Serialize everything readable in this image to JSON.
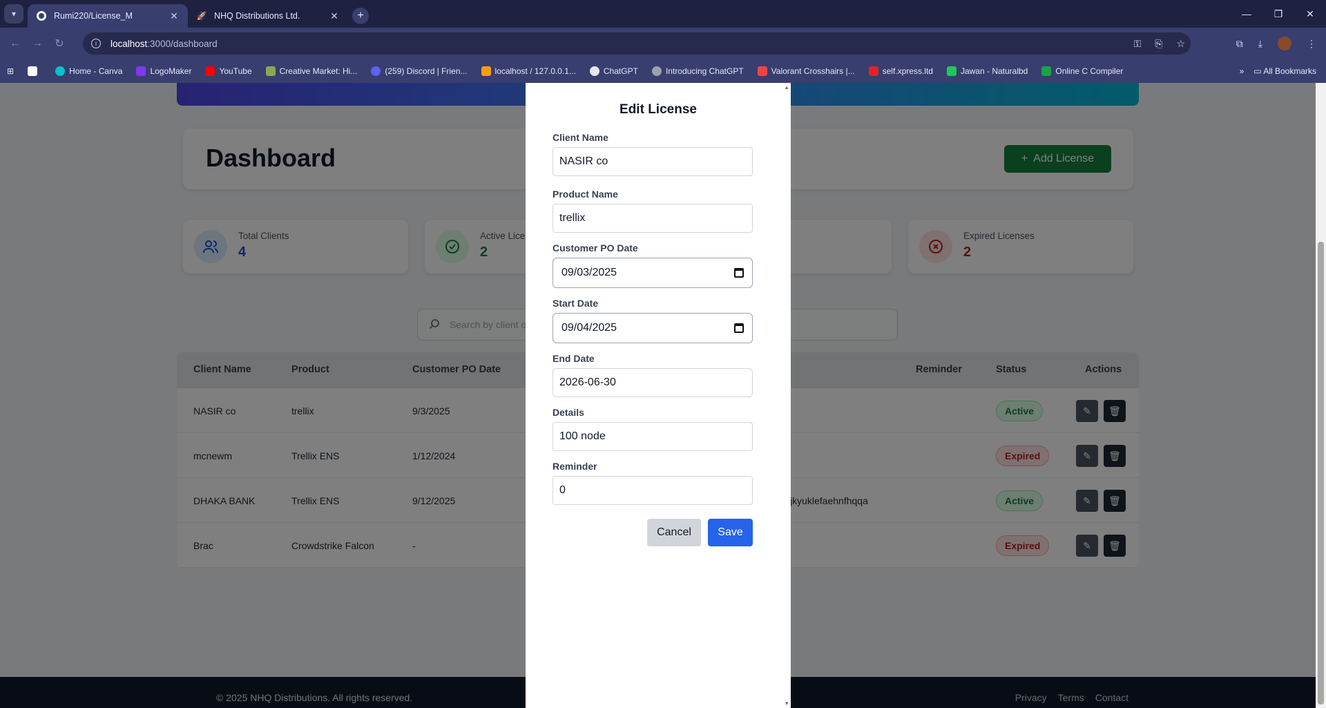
{
  "browser": {
    "tabs": [
      {
        "label": "Rumi220/License_M",
        "icon": "github-icon"
      },
      {
        "label": "NHQ Distributions Ltd.",
        "icon": "rocket-icon"
      }
    ],
    "url_host": "localhost",
    "url_path": ":3000/dashboard",
    "bookmarks": [
      {
        "label": "Home - Canva",
        "color": "#00c4cc"
      },
      {
        "label": "LogoMaker",
        "color": "#7c3aed"
      },
      {
        "label": "YouTube",
        "color": "#ff0000"
      },
      {
        "label": "Creative Market: Hi...",
        "color": "#8ba753"
      },
      {
        "label": "(259) Discord | Frien...",
        "color": "#5865f2"
      },
      {
        "label": "localhost / 127.0.0.1...",
        "color": "#f59e0b"
      },
      {
        "label": "ChatGPT",
        "color": "#e5e7eb"
      },
      {
        "label": "Introducing ChatGPT",
        "color": "#9ca3af"
      },
      {
        "label": "Valorant Crosshairs |...",
        "color": "#ef4444"
      },
      {
        "label": "self.xpress.ltd",
        "color": "#dc2626"
      },
      {
        "label": "Jawan - Naturalbd",
        "color": "#22c55e"
      },
      {
        "label": "Online C Compiler",
        "color": "#16a34a"
      }
    ],
    "all_bookmarks": "All Bookmarks"
  },
  "dashboard": {
    "title": "Dashboard",
    "add_button": "Add License",
    "stats": [
      {
        "label": "Total Clients",
        "value": "4",
        "color": "#1d4ed8",
        "bg": "#dbeafe"
      },
      {
        "label": "Active Lice",
        "value": "2",
        "color": "#15803d",
        "bg": "#dcfce7"
      },
      {
        "label": "Expired Licenses",
        "value": "2",
        "color": "#b91c1c",
        "bg": "#fee2e2"
      }
    ],
    "search_placeholder": "Search by client o"
  },
  "table": {
    "headers": [
      "Client Name",
      "Product",
      "Customer PO Date",
      "Reminder",
      "Status",
      "Actions"
    ],
    "rows": [
      {
        "client": "NASIR co",
        "product": "trellix",
        "po_date": "9/3/2025",
        "extra": "",
        "status": "Active"
      },
      {
        "client": "mcnewm",
        "product": "Trellix ENS",
        "po_date": "1/12/2024",
        "extra": "",
        "status": "Expired"
      },
      {
        "client": "DHAKA BANK",
        "product": "Trellix ENS",
        "po_date": "9/12/2025",
        "extra": "jkyuklefaehnfhqqa",
        "status": "Active"
      },
      {
        "client": "Brac",
        "product": "Crowdstrike Falcon",
        "po_date": "-",
        "extra": "",
        "status": "Expired"
      }
    ]
  },
  "footer": {
    "copyright": "© 2025 NHQ Distributions. All rights reserved.",
    "links": [
      "Privacy",
      "Terms",
      "Contact"
    ]
  },
  "modal": {
    "title": "Edit License",
    "client_name_label": "Client Name",
    "client_name_value": "NASIR co",
    "product_name_label": "Product Name",
    "product_name_value": "trellix",
    "po_date_label": "Customer PO Date",
    "po_date_value": "09/03/2025",
    "start_date_label": "Start Date",
    "start_date_value": "09/04/2025",
    "end_date_label": "End Date",
    "end_date_value": "2026-06-30",
    "details_label": "Details",
    "details_value": "100 node",
    "reminder_label": "Reminder",
    "reminder_value": "0",
    "cancel": "Cancel",
    "save": "Save"
  }
}
